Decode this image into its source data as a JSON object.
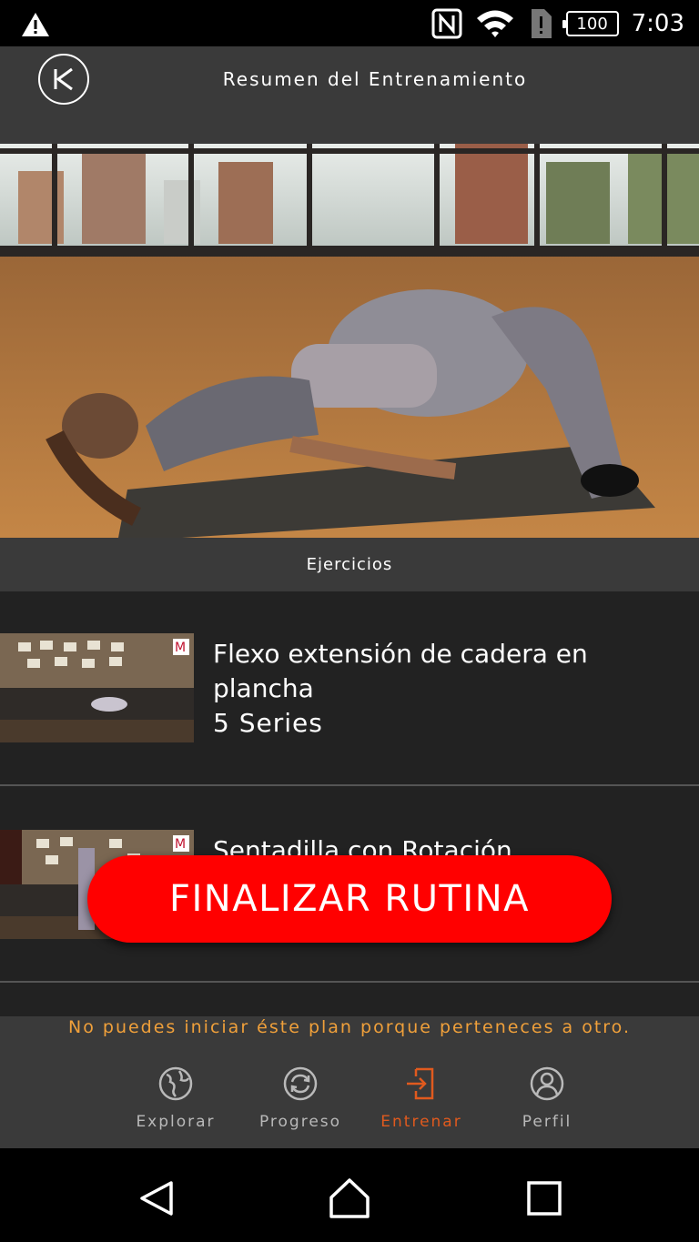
{
  "status_bar": {
    "time": "7:03",
    "battery": "100",
    "icons": [
      "warning-icon",
      "nfc-icon",
      "wifi-icon",
      "sim-alert-icon",
      "battery-icon"
    ]
  },
  "header": {
    "title": "Resumen del Entrenamiento",
    "back_icon": "skip-back-icon"
  },
  "section": {
    "title": "Ejercicios"
  },
  "exercises": [
    {
      "title": "Flexo extensión de cadera en plancha",
      "series": "5 Series"
    },
    {
      "title": "Sentadilla con Rotación",
      "series": ""
    }
  ],
  "finish_button": "FINALIZAR RUTINA",
  "notice": "No puedes iniciar éste plan porque perteneces a otro.",
  "tabs": [
    {
      "label": "Explorar",
      "icon": "globe-icon",
      "active": false
    },
    {
      "label": "Progreso",
      "icon": "sync-icon",
      "active": false
    },
    {
      "label": "Entrenar",
      "icon": "enter-icon",
      "active": true
    },
    {
      "label": "Perfil",
      "icon": "user-icon",
      "active": false
    }
  ],
  "colors": {
    "accent": "#ff0000",
    "active_tab": "#e05a1e",
    "notice": "#f0a03a",
    "bar_bg": "#3a3a3a",
    "list_bg": "#222222"
  }
}
